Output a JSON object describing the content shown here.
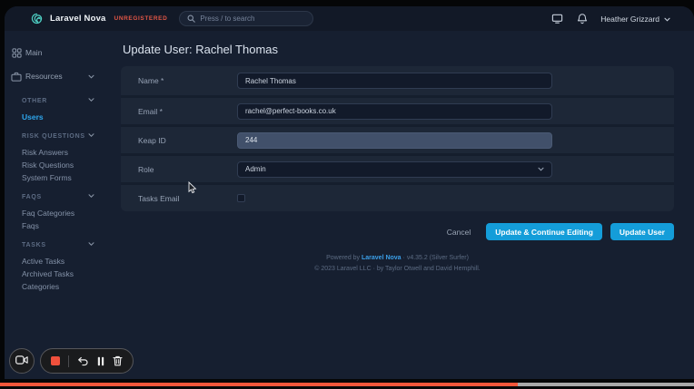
{
  "topbar": {
    "brand": "Laravel Nova",
    "badge": "UNREGISTERED",
    "search_placeholder": "Press / to search",
    "user_name": "Heather Grizzard"
  },
  "sidebar": {
    "items_top": [
      {
        "label": "Main"
      },
      {
        "label": "Resources"
      }
    ],
    "groups": [
      {
        "header": "OTHER",
        "items": [
          "Users"
        ]
      },
      {
        "header": "RISK QUESTIONS",
        "items": [
          "Risk Answers",
          "Risk Questions",
          "System Forms"
        ]
      },
      {
        "header": "FAQS",
        "items": [
          "Faq Categories",
          "Faqs"
        ]
      },
      {
        "header": "TASKS",
        "items": [
          "Active Tasks",
          "Archived Tasks",
          "Categories"
        ]
      }
    ],
    "active_item": "Users"
  },
  "main": {
    "title": "Update User: Rachel Thomas",
    "form": {
      "name_label": "Name *",
      "name_value": "Rachel Thomas",
      "email_label": "Email *",
      "email_value": "rachel@perfect-books.co.uk",
      "keap_label": "Keap ID",
      "keap_value": "244",
      "keap_readonly": true,
      "role_label": "Role",
      "role_value": "Admin",
      "tasks_email_label": "Tasks Email",
      "tasks_email_checked": false
    },
    "actions": {
      "cancel": "Cancel",
      "update_continue": "Update & Continue Editing",
      "update": "Update User"
    }
  },
  "footer": {
    "line1_prefix": "Powered by ",
    "line1_link": "Laravel Nova",
    "line1_suffix": " · v4.35.2 (Silver Surfer)",
    "line2": "© 2023 Laravel LLC · by Taylor Otwell and David Hemphill."
  },
  "video_overlay": {
    "progress_pct": 75
  },
  "icons": {
    "nova-logo": "teal spiral",
    "search": "magnifier",
    "screen": "monitor",
    "notifications": "bell",
    "user-menu-chevron": "chevron-down",
    "main": "grid",
    "resources": "briefcase",
    "camera": "video-camera",
    "stop": "red square",
    "undo": "curved arrow",
    "pause": "double bars",
    "delete": "trash bin"
  },
  "colors": {
    "accent_blue": "#149dd9",
    "active_link_blue": "#2ea7ee",
    "brand_teal": "#4fd1c5",
    "unregistered_red": "#e25646",
    "progress_orange": "#f4563a",
    "window_bg": "#161f30",
    "card_bg": "#1d2737"
  }
}
